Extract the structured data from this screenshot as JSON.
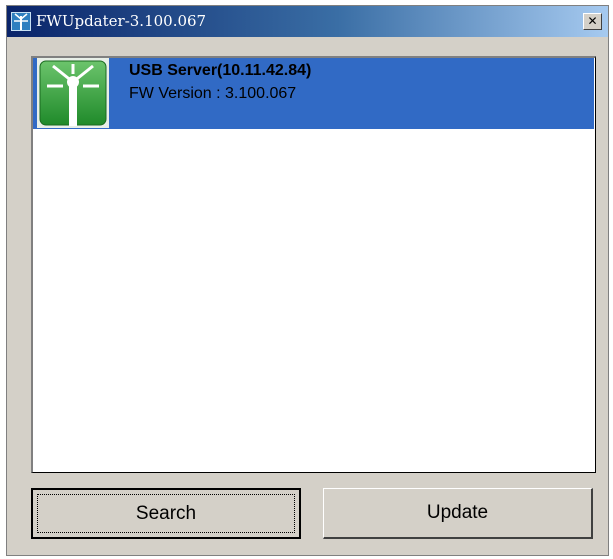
{
  "window": {
    "title": "FWUpdater-3.100.067",
    "close_glyph": "✕",
    "icon": "fwupdater-app-icon"
  },
  "device_list": {
    "items": [
      {
        "name": "USB Server(10.11.42.84)",
        "fw_version": "FW Version : 3.100.067",
        "icon": "usb-server-device-icon",
        "selected": true
      }
    ]
  },
  "buttons": {
    "search_label": "Search",
    "update_label": "Update"
  },
  "colors": {
    "selection": "#316ac5",
    "titlebar_start": "#0a246a",
    "titlebar_end": "#a6caf0",
    "dialog_face": "#d4d0c8",
    "device_icon_green": "#2f9e2f"
  }
}
